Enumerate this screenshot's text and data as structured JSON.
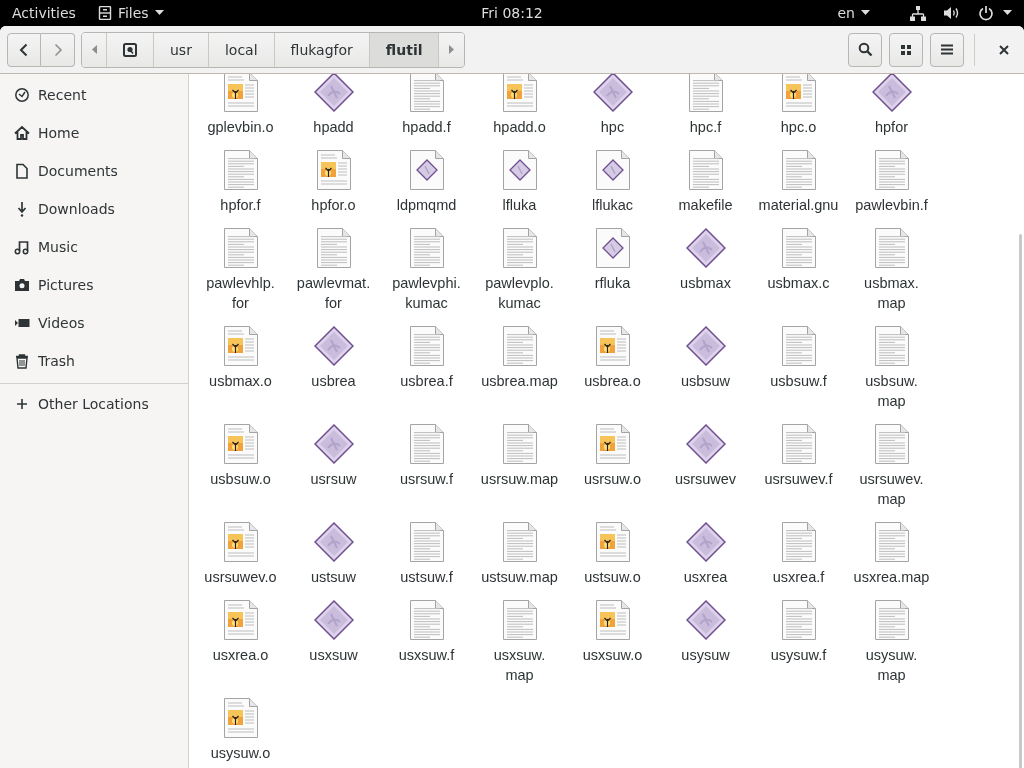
{
  "top_bar": {
    "activities": "Activities",
    "app_menu": "Files",
    "clock": "Fri 08:12",
    "input_source": "en"
  },
  "header": {
    "path": [
      {
        "kind": "root",
        "selected": false
      },
      {
        "label": "usr",
        "kind": "folder",
        "selected": false
      },
      {
        "label": "local",
        "kind": "folder",
        "selected": false
      },
      {
        "label": "flukagfor",
        "kind": "folder",
        "selected": false
      },
      {
        "label": "flutil",
        "kind": "folder",
        "selected": true
      }
    ]
  },
  "sidebar": {
    "items": [
      {
        "label": "Recent"
      },
      {
        "label": "Home"
      },
      {
        "label": "Documents"
      },
      {
        "label": "Downloads"
      },
      {
        "label": "Music"
      },
      {
        "label": "Pictures"
      },
      {
        "label": "Videos"
      },
      {
        "label": "Trash"
      }
    ],
    "other": {
      "label": "Other Locations"
    }
  },
  "files": [
    {
      "name": "gplevbin.o",
      "kind": "object"
    },
    {
      "name": "hpadd",
      "kind": "exec"
    },
    {
      "name": "hpadd.f",
      "kind": "text"
    },
    {
      "name": "hpadd.o",
      "kind": "object"
    },
    {
      "name": "hpc",
      "kind": "exec"
    },
    {
      "name": "hpc.f",
      "kind": "text"
    },
    {
      "name": "hpc.o",
      "kind": "object"
    },
    {
      "name": "hpfor",
      "kind": "exec"
    },
    {
      "name": "hpfor.f",
      "kind": "text"
    },
    {
      "name": "hpfor.o",
      "kind": "object"
    },
    {
      "name": "ldpmqmd",
      "kind": "script"
    },
    {
      "name": "lfluka",
      "kind": "script"
    },
    {
      "name": "lflukac",
      "kind": "script"
    },
    {
      "name": "makefile",
      "kind": "text"
    },
    {
      "name": "material.gnu",
      "kind": "text"
    },
    {
      "name": "pawlevbin.f",
      "kind": "text"
    },
    {
      "name": "pawlevhlp.for",
      "kind": "text",
      "wrap": true
    },
    {
      "name": "pawlevmat.for",
      "kind": "text",
      "wrap": true
    },
    {
      "name": "pawlevphi.kumac",
      "kind": "text",
      "wrap": true
    },
    {
      "name": "pawlevplo.kumac",
      "kind": "text",
      "wrap": true
    },
    {
      "name": "rfluka",
      "kind": "script"
    },
    {
      "name": "usbmax",
      "kind": "exec"
    },
    {
      "name": "usbmax.c",
      "kind": "text"
    },
    {
      "name": "usbmax.map",
      "kind": "text",
      "wrap": true
    },
    {
      "name": "usbmax.o",
      "kind": "object"
    },
    {
      "name": "usbrea",
      "kind": "exec"
    },
    {
      "name": "usbrea.f",
      "kind": "text"
    },
    {
      "name": "usbrea.map",
      "kind": "text"
    },
    {
      "name": "usbrea.o",
      "kind": "object"
    },
    {
      "name": "usbsuw",
      "kind": "exec"
    },
    {
      "name": "usbsuw.f",
      "kind": "text"
    },
    {
      "name": "usbsuw.map",
      "kind": "text",
      "wrap": true
    },
    {
      "name": "usbsuw.o",
      "kind": "object"
    },
    {
      "name": "usrsuw",
      "kind": "exec"
    },
    {
      "name": "usrsuw.f",
      "kind": "text"
    },
    {
      "name": "usrsuw.map",
      "kind": "text"
    },
    {
      "name": "usrsuw.o",
      "kind": "object"
    },
    {
      "name": "usrsuwev",
      "kind": "exec"
    },
    {
      "name": "usrsuwev.f",
      "kind": "text"
    },
    {
      "name": "usrsuwev.map",
      "kind": "text",
      "wrap": true
    },
    {
      "name": "usrsuwev.o",
      "kind": "object"
    },
    {
      "name": "ustsuw",
      "kind": "exec"
    },
    {
      "name": "ustsuw.f",
      "kind": "text"
    },
    {
      "name": "ustsuw.map",
      "kind": "text"
    },
    {
      "name": "ustsuw.o",
      "kind": "object"
    },
    {
      "name": "usxrea",
      "kind": "exec"
    },
    {
      "name": "usxrea.f",
      "kind": "text"
    },
    {
      "name": "usxrea.map",
      "kind": "text"
    },
    {
      "name": "usxrea.o",
      "kind": "object"
    },
    {
      "name": "usxsuw",
      "kind": "exec"
    },
    {
      "name": "usxsuw.f",
      "kind": "text"
    },
    {
      "name": "usxsuw.map",
      "kind": "text",
      "wrap": true
    },
    {
      "name": "usxsuw.o",
      "kind": "object"
    },
    {
      "name": "usysuw",
      "kind": "exec"
    },
    {
      "name": "usysuw.f",
      "kind": "text"
    },
    {
      "name": "usysuw.map",
      "kind": "text",
      "wrap": true
    },
    {
      "name": "usysuw.o",
      "kind": "object"
    }
  ]
}
